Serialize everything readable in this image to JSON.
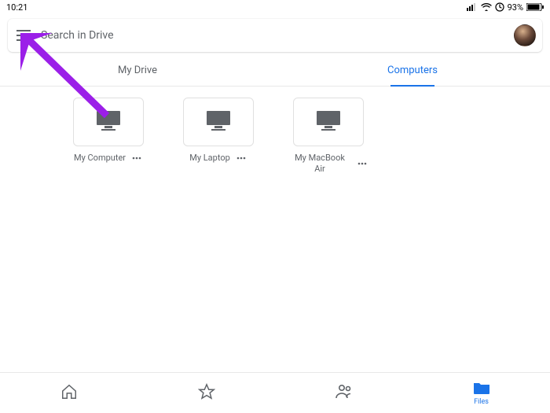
{
  "statusbar": {
    "time": "10:21",
    "battery": "93%"
  },
  "search": {
    "placeholder": "Search in Drive"
  },
  "tabs": {
    "my_drive": "My Drive",
    "computers": "Computers"
  },
  "items": [
    {
      "label": "My Computer"
    },
    {
      "label": "My Laptop"
    },
    {
      "label": "My MacBook Air"
    }
  ],
  "bottom": {
    "home": "Home",
    "starred": "Starred",
    "shared": "Shared",
    "files": "Files"
  },
  "annotation": {
    "color": "#9b1fe8"
  }
}
